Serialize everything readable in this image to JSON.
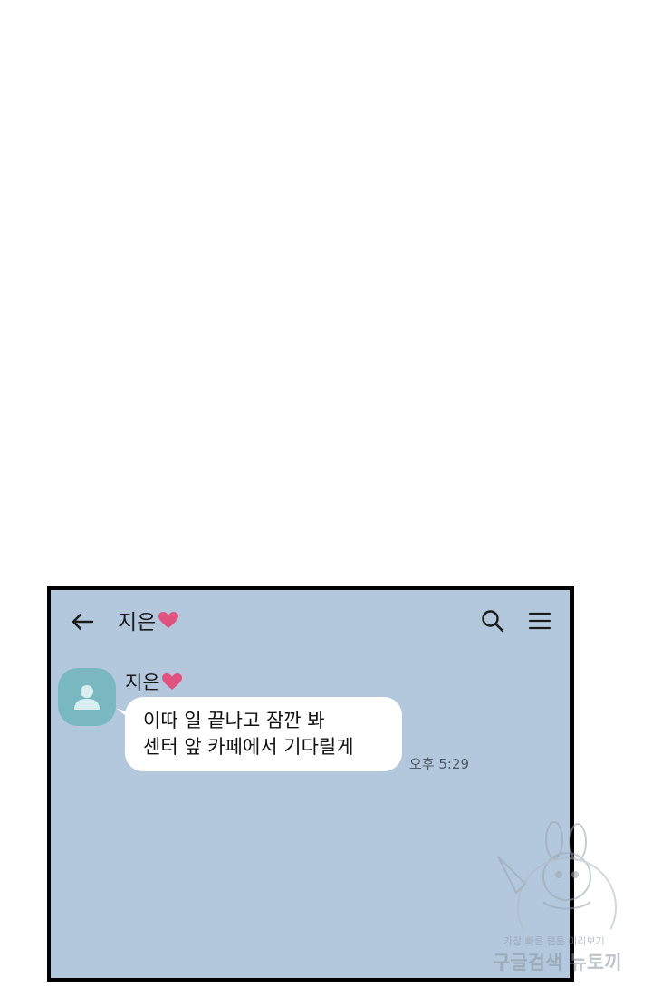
{
  "topbar": {
    "title": "지은",
    "title_icon": "heart-icon",
    "back_icon": "arrow-left-icon",
    "search_icon": "search-icon",
    "menu_icon": "menu-icon"
  },
  "message": {
    "sender": "지은",
    "sender_icon": "heart-icon",
    "avatar_icon": "person-icon",
    "lines": [
      "이따 일 끝나고 잠깐 봐",
      "센터 앞 카페에서 기다릴게"
    ],
    "time": "오후 5:29"
  },
  "watermark": {
    "line1": "가장 빠른 웹툰 미리보기",
    "line2": "구글검색 뉴토끼"
  },
  "colors": {
    "chat_background": "#b3c8dc",
    "heart": "#e0537f",
    "avatar": "#79b7c1",
    "bubble": "#ffffff"
  }
}
